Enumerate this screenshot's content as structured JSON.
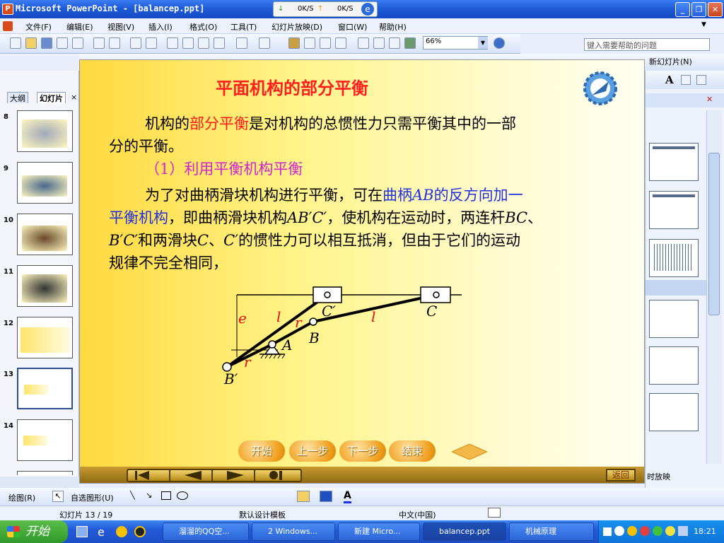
{
  "window": {
    "title": "Microsoft PowerPoint - [balancep.ppt]",
    "min": "_",
    "max": "❐",
    "close": "✕"
  },
  "net_meter": {
    "down": "0K/S",
    "up": "0K/S"
  },
  "menu": {
    "items": [
      "文件(F)",
      "编辑(E)",
      "视图(V)",
      "插入(I)",
      "格式(O)",
      "工具(T)",
      "幻灯片放映(D)",
      "窗口(W)",
      "帮助(H)"
    ],
    "help_placeholder": "键入需要帮助的问题"
  },
  "toolbar": {
    "zoom": "66%",
    "new_slide": "新幻灯片(N)"
  },
  "outline": {
    "tabs": [
      "大纲",
      "幻灯片"
    ],
    "slides": [
      "8",
      "9",
      "10",
      "11",
      "12",
      "13",
      "14"
    ],
    "selected": "13"
  },
  "slide": {
    "title": "平面机构的部分平衡",
    "para1_a": "机构的",
    "para1_b": "部分平衡",
    "para1_c": "是对机构的总惯性力只需平衡其中的一部",
    "para1_d": "分的平衡。",
    "heading": "（1）利用平衡机构平衡",
    "para2_a": "为了对曲柄滑块机构进行平衡，可在",
    "para2_b": "曲柄",
    "para2_c": "AB",
    "para2_d": "的反方向加一",
    "para2_e": "平衡机构",
    "para2_f": "，即曲柄滑块机构",
    "para2_g": "AB′C′",
    "para2_h": "，使机构在运动时，两连杆",
    "para2_i": "BC",
    "para2_j": "、",
    "para3_a": "B′C′",
    "para3_b": "和两滑块",
    "para3_c": "C",
    "para3_d": "、",
    "para3_e": "C′",
    "para3_f": "的惯性力可以相互抵消，但由于它们的运动",
    "para4": "规律不完全相同，",
    "diagram_labels": {
      "e": "e",
      "l1": "l",
      "r1": "r",
      "Cp": "C′",
      "C": "C",
      "l2": "l",
      "B": "B",
      "A": "A",
      "r2": "r",
      "Bp": "B′"
    },
    "nav": [
      "开始",
      "上一步",
      "下一步",
      "结束"
    ],
    "return": "返回"
  },
  "taskpane": {
    "bottom_label": "时放映"
  },
  "drawbar": {
    "draw": "绘图(R)",
    "autoshape": "自选图形(U)"
  },
  "status": {
    "slide": "幻灯片 13 / 19",
    "template": "默认设计模板",
    "lang": "中文(中国)"
  },
  "taskbar": {
    "start": "开始",
    "buttons": [
      "溜溜的QQ空...",
      "2 Windows...",
      "新建 Micro...",
      "balancep.ppt",
      "机械原理"
    ],
    "clock": "18:21"
  }
}
